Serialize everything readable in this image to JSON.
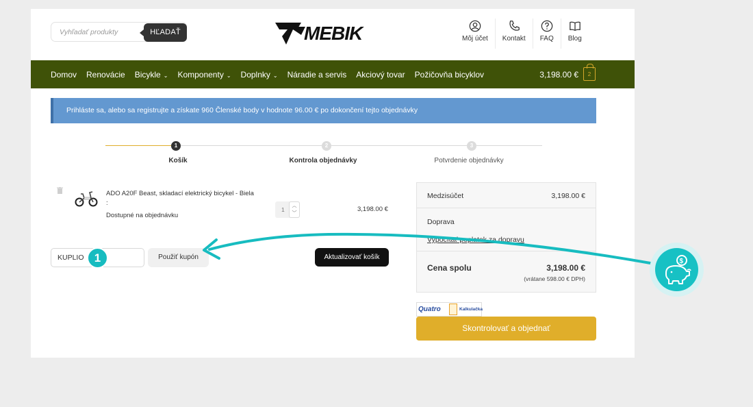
{
  "header": {
    "search_placeholder": "Vyhľadať produkty",
    "search_button": "HĽADAŤ",
    "logo_text": "MEBIK",
    "links": [
      {
        "label": "Môj účet",
        "icon": "user-icon"
      },
      {
        "label": "Kontakt",
        "icon": "phone-icon"
      },
      {
        "label": "FAQ",
        "icon": "help-icon"
      },
      {
        "label": "Blog",
        "icon": "book-icon"
      }
    ]
  },
  "nav": {
    "items": [
      "Domov",
      "Renovácie",
      "Bicykle",
      "Komponenty",
      "Doplnky",
      "Náradie a servis",
      "Akciový tovar",
      "Požičovňa bicyklov"
    ],
    "cart_total": "3,198.00 €",
    "cart_count": "2"
  },
  "notice": "Prihláste sa, alebo sa registrujte a získate 960 Členské body v hodnote 96.00 € po dokončení tejto objednávky",
  "steps": [
    {
      "number": "1",
      "label": "Košík"
    },
    {
      "number": "2",
      "label": "Kontrola objednávky"
    },
    {
      "number": "3",
      "label": "Potvrdenie objednávky"
    }
  ],
  "cart": {
    "product_name": "ADO A20F Beast, skladací elektrický bicykel - Biela",
    "product_colon": ":",
    "availability": "Dostupné na objednávku",
    "quantity": "1",
    "price": "3,198.00 €",
    "coupon_value": "KUPLIO",
    "apply_coupon": "Použiť kupón",
    "update_cart": "Aktualizovať košík"
  },
  "totals": {
    "subtotal_label": "Medzisúčet",
    "subtotal_value": "3,198.00 €",
    "shipping_label": "Doprava",
    "shipping_calc": "Vypočítať poplatok za dopravu",
    "total_label": "Cena spolu",
    "total_value": "3,198.00 €",
    "vat_note": "(vrátane 598.00 € DPH)"
  },
  "quatro": {
    "brand": "Quatro",
    "calculator": "Kalkulačka"
  },
  "checkout_button": "Skontrolovať a objednať",
  "overlay": {
    "badge_number": "1",
    "piggy_coin": "$"
  },
  "colors": {
    "nav": "#3f5208",
    "accent": "#e0ae2a",
    "notice": "#6398d0",
    "teal": "#17bcc0"
  }
}
